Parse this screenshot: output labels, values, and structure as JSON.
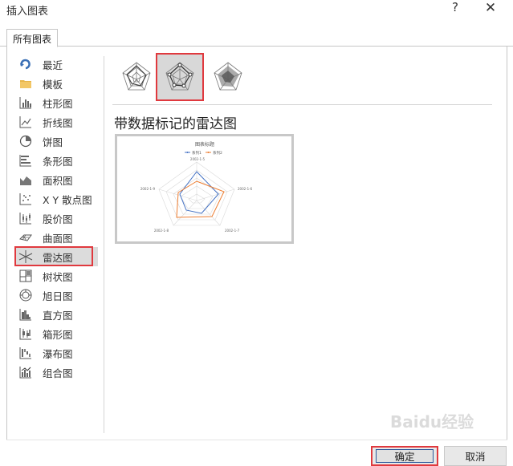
{
  "window": {
    "title": "插入图表",
    "help": "?",
    "close": "✕"
  },
  "tabs": [
    {
      "label": "所有图表"
    }
  ],
  "sidebar": {
    "items": [
      {
        "label": "最近",
        "icon": "recent-icon"
      },
      {
        "label": "模板",
        "icon": "folder-icon"
      },
      {
        "label": "柱形图",
        "icon": "column-chart-icon"
      },
      {
        "label": "折线图",
        "icon": "line-chart-icon"
      },
      {
        "label": "饼图",
        "icon": "pie-chart-icon"
      },
      {
        "label": "条形图",
        "icon": "bar-chart-icon"
      },
      {
        "label": "面积图",
        "icon": "area-chart-icon"
      },
      {
        "label": "X Y 散点图",
        "icon": "scatter-chart-icon"
      },
      {
        "label": "股价图",
        "icon": "stock-chart-icon"
      },
      {
        "label": "曲面图",
        "icon": "surface-chart-icon"
      },
      {
        "label": "雷达图",
        "icon": "radar-chart-icon",
        "selected": true
      },
      {
        "label": "树状图",
        "icon": "treemap-chart-icon"
      },
      {
        "label": "旭日图",
        "icon": "sunburst-chart-icon"
      },
      {
        "label": "直方图",
        "icon": "histogram-chart-icon"
      },
      {
        "label": "箱形图",
        "icon": "box-chart-icon"
      },
      {
        "label": "瀑布图",
        "icon": "waterfall-chart-icon"
      },
      {
        "label": "组合图",
        "icon": "combo-chart-icon"
      }
    ]
  },
  "subtypes": [
    {
      "name": "radar",
      "selected": false
    },
    {
      "name": "radar-with-markers",
      "selected": true
    },
    {
      "name": "filled-radar",
      "selected": false
    }
  ],
  "selected_subtype_title": "带数据标记的雷达图",
  "preview": {
    "title": "图表标题",
    "legend": [
      "系列1",
      "系列2"
    ],
    "axis_labels": [
      "2002-1-5",
      "2002-1-6",
      "2002-1-7",
      "2002-1-8",
      "2002-1-9"
    ],
    "series_colors": [
      "#4472c4",
      "#ed7d31"
    ]
  },
  "buttons": {
    "ok": "确定",
    "cancel": "取消"
  },
  "watermark": "Baidu经验",
  "colors": {
    "highlight": "#e0393e",
    "selected_bg": "#dcdcdc"
  }
}
